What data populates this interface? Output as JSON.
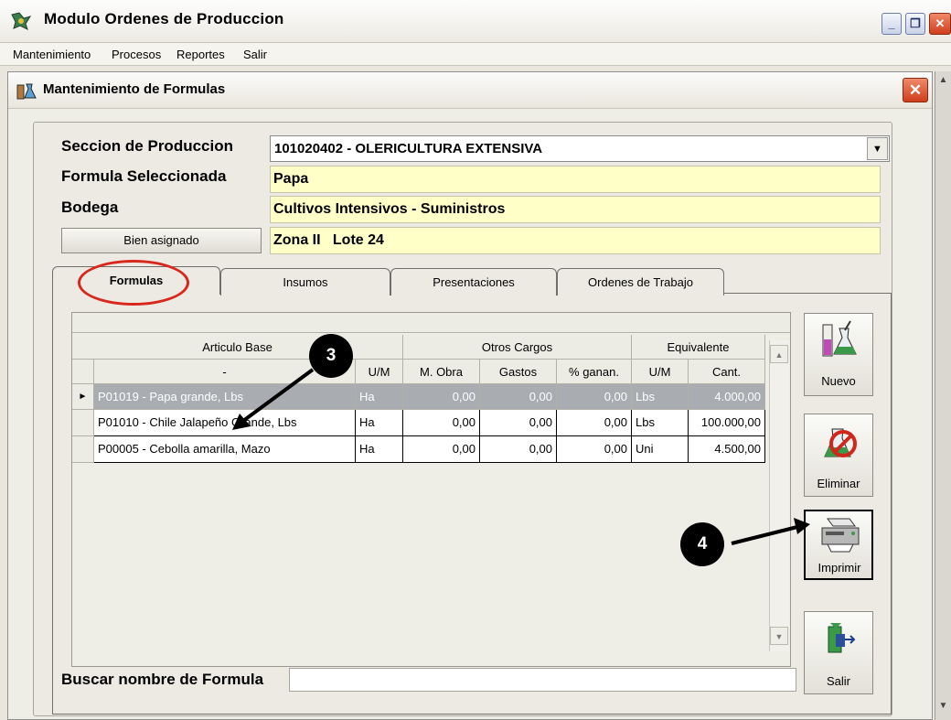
{
  "window": {
    "title": "Modulo Ordenes de Produccion",
    "minimize": "_",
    "restore": "❐",
    "close": "✕"
  },
  "menu": [
    "Mantenimiento",
    "Procesos",
    "Reportes",
    "Salir"
  ],
  "dialog": {
    "title": "Mantenimiento de Formulas",
    "close": "✕"
  },
  "form": {
    "seccion_label": "Seccion de Produccion",
    "seccion_value": "101020402 - OLERICULTURA EXTENSIVA",
    "formula_label": "Formula Seleccionada",
    "formula_value": "Papa",
    "bodega_label": "Bodega",
    "bodega_value": "Cultivos Intensivos - Suministros",
    "bien_button": "Bien asignado",
    "bien_value": "Zona II   Lote 24"
  },
  "tabs": [
    "Formulas",
    "Insumos",
    "Presentaciones",
    "Ordenes de Trabajo"
  ],
  "grid": {
    "group_headers": {
      "articulo": "Articulo Base",
      "otros": "Otros Cargos",
      "equivalente": "Equivalente"
    },
    "columns": [
      "-",
      "U/M",
      "M. Obra",
      "Gastos",
      "% ganan.",
      "U/M",
      "Cant."
    ],
    "row_pointer": "►",
    "rows": [
      [
        "P01019 - Papa grande, Lbs",
        "Ha",
        "0,00",
        "0,00",
        "0,00",
        "Lbs",
        "4.000,00"
      ],
      [
        "P01010 - Chile Jalapeño Grande, Lbs",
        "Ha",
        "0,00",
        "0,00",
        "0,00",
        "Lbs",
        "100.000,00"
      ],
      [
        "P00005 - Cebolla amarilla, Mazo",
        "Ha",
        "0,00",
        "0,00",
        "0,00",
        "Uni",
        "4.500,00"
      ]
    ]
  },
  "buttons": {
    "nuevo": "Nuevo",
    "eliminar": "Eliminar",
    "imprimir": "Imprimir",
    "salir": "Salir"
  },
  "search": {
    "label": "Buscar nombre de Formula",
    "value": ""
  },
  "annotations": {
    "marker3": "3",
    "marker4": "4"
  }
}
